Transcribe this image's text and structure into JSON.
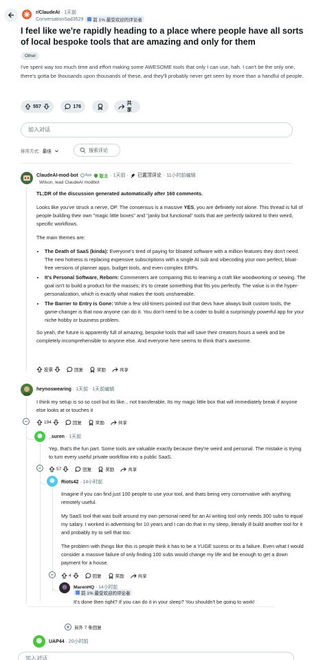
{
  "post": {
    "subreddit": "r/ClaudeAI",
    "post_time": "· 1天前",
    "author": "ConversationSad3529",
    "author_badge": "前 1% 最受欢迎的评论者",
    "title": "I feel like we're rapidly heading to a place where people have all sorts of local bespoke tools that are amazing and only for them",
    "flair": "Other",
    "body": "I've spent way too much time and effort making some AWESOME tools that only I can use, hah. I can't be the only one, there's gotta be thousands upon thousands of these, and they'll probably never get seen by more than a handful of people.",
    "votes": "557",
    "comments": "176",
    "share_label": "共享"
  },
  "comment_input": {
    "placeholder": "加入对话"
  },
  "sort": {
    "label": "排序方式:",
    "value": "最佳",
    "search_placeholder": "搜索评论"
  },
  "mod_comment": {
    "author": "ClaudeAI-mod-bot",
    "app_badge": "App",
    "mod_badge": "版主",
    "time": "· 1天前 ·",
    "pinned": "已置顶评论",
    "edited": "· 11小时前编辑",
    "flair": "Wilson, lead ClaudeAI modbot",
    "tldr": "TL;DR of the discussion generated automatically after 160 comments.",
    "p1_pre": "Looks like you've struck a nerve, OP. The consensus is a massive ",
    "p1_bold": "YES",
    "p1_post": ", you are definitely not alone. This thread is full of people building their own \"magic little boxes\" and \"janky but functional\" tools that are perfectly tailored to their weird, specific workflows.",
    "themes_intro": "The main themes are:",
    "themes": [
      {
        "title": "The Death of SaaS (kinda):",
        "text": " Everyone's tired of paying for bloated software with a million features they don't need. The new hotness is replacing expensive subscriptions with a single AI sub and vibecoding your own perfect, bloat-free versions of planner apps, budget tools, and even complex ERPs."
      },
      {
        "title": "It's Personal Software, Reborn:",
        "text": " Commenters are comparing this to learning a craft like woodworking or sewing. The goal isn't to build a product for the masses; it's to create something that fits you perfectly. The value is in the hyper-personalization, which is exactly what makes the tools unshareable."
      },
      {
        "title": "The Barrier to Entry is Gone:",
        "text": " While a few old-timers pointed out that devs have always built custom tools, the game-changer is that now anyone can do it. You don't need to be a coder to build a surprisingly powerful app for your niche hobby or business problem."
      }
    ],
    "closing": "So yeah, the future is apparently full of amazing, bespoke tools that will save their creators hours a week and be completely incomprehensible to anyone else. And everyone here seems to think that's awesome.",
    "vote_label": "投票",
    "reply": "回复",
    "award": "奖励",
    "share": "共享"
  },
  "comments": [
    {
      "author": "heynoswearing",
      "time": "· 1天前 · 1天前编辑",
      "text": "I think my setup is so so cool but its like... not transferable. Its my magic little box that will immediately break if anyone else looks at or touches it",
      "votes": "194",
      "color": "#4a7a3a"
    },
    {
      "author": "_suren",
      "time": "· 1天前",
      "text": "Yep, that's the fun part. Some tools are valuable exactly because they're weird and personal. The mistake is trying to turn every useful private workflow into a public SaaS.",
      "votes": "57",
      "color": "#46c84a"
    },
    {
      "author": "Riots42",
      "time": "· 14小时前",
      "p1": "Imagine if you can find just 100 people to use your tool, and thats being very conservative with anything remotely useful.",
      "p2": "My SaaS tool that was built around my own personal need for an AI writing tool only needs 300 subs to equal my salary. I worked in advertising for 10 years and I can do that in my sleep, literally ill build another tool for it and probably try to sell that too.",
      "p3": "The problem with things like this is people think it has to be a YUGE sucess or its a failure. Even what I would consider a massive failure of only finding 100 subs would change my life and be enough to get a down payment for a house.",
      "votes": "4",
      "color": "#55c7e8"
    },
    {
      "author": "MarenHQ",
      "time": "· 14小时前",
      "badge": "前 1% 最受欢迎的评论者",
      "text": "It's done then right? If you can do it in your sleep? You shouldn't be going to work!",
      "color": "#2a2a2a"
    }
  ],
  "more_replies": "另外 7 条回复",
  "last_comment": {
    "author": "UAP44",
    "time": "· 20小时前",
    "color": "#4ec43c"
  },
  "bottom_input": {
    "placeholder": "加入对话"
  }
}
